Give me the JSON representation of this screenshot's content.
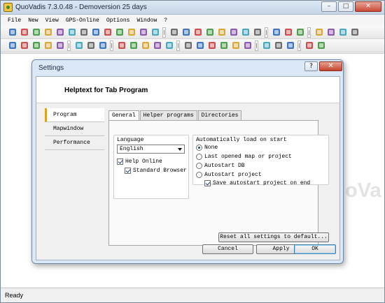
{
  "window": {
    "title": "QuoVadis 7.3.0.48 - Demoversion 25 days",
    "minimize": "–",
    "maximize": "□",
    "close": "✕"
  },
  "menu": [
    "File",
    "New",
    "View",
    "GPS-Online",
    "Options",
    "Window",
    "?"
  ],
  "workspace": {
    "watermark": "oVa"
  },
  "status": {
    "text": "Ready"
  },
  "dialog": {
    "title": "Settings",
    "help_button": "?",
    "close_button": "✕",
    "header": "Helptext for Tab Program",
    "nav": [
      "Program",
      "Mapwindow",
      "Performance"
    ],
    "tabs": [
      "General",
      "Helper programs",
      "Directories"
    ],
    "language": {
      "title": "Language",
      "selected": "English",
      "help_online": {
        "label": "Help Online",
        "checked": true
      },
      "standard_browser": {
        "label": "Standard Browser",
        "checked": true
      }
    },
    "autoload": {
      "title": "Automatically load on start",
      "options": [
        "None",
        "Last opened map or project",
        "Autostart DB",
        "Autostart project"
      ],
      "selected_index": 0,
      "save_autostart": {
        "label": "Save autostart project on end",
        "checked": true
      }
    },
    "reset_button": "Reset all settings to default...",
    "buttons": {
      "cancel": "Cancel",
      "apply": "Apply",
      "ok": "OK"
    }
  },
  "colors": {
    "title_gradient": "#c6d6e8",
    "dialog_frame": "#dbe8f6",
    "close_red": "#c74a36",
    "nav_active_accent": "#e0a020"
  },
  "toolbar1_icons": [
    "scissors-icon",
    "paste-icon",
    "copy-icon",
    "print-icon",
    "binoculars-icon",
    "search-list-icon",
    "grid-icon",
    "map-icon",
    "layers-icon",
    "target-icon",
    "list-icon",
    "table-icon",
    "wand-icon",
    "zoom-in-icon",
    "zoom-out-icon",
    "zoom-fit-icon",
    "zoom-window-icon",
    "zoom-1-icon",
    "zoom-3d-icon",
    "zoom-select-icon",
    "gps-icon",
    "compass-icon",
    "minus-circle-icon",
    "pie-icon",
    "tool-a-icon",
    "tool-b-icon",
    "tool-c-icon",
    "tool-d-icon"
  ],
  "toolbar2_icons": [
    "route-a-icon",
    "route-b-icon",
    "route-c-icon",
    "route-d-icon",
    "route-e-icon",
    "edit-icon",
    "arrow-left-icon",
    "arrow-right-icon",
    "cursor-icon",
    "pan-icon",
    "measure-icon",
    "waypoint-icon",
    "delete-icon",
    "track-a-icon",
    "track-b-icon",
    "track-c-icon",
    "track-d-icon",
    "track-e-icon",
    "align-icon",
    "split-icon",
    "join-icon",
    "stats-icon",
    "lock-icon",
    "settings-icon"
  ]
}
